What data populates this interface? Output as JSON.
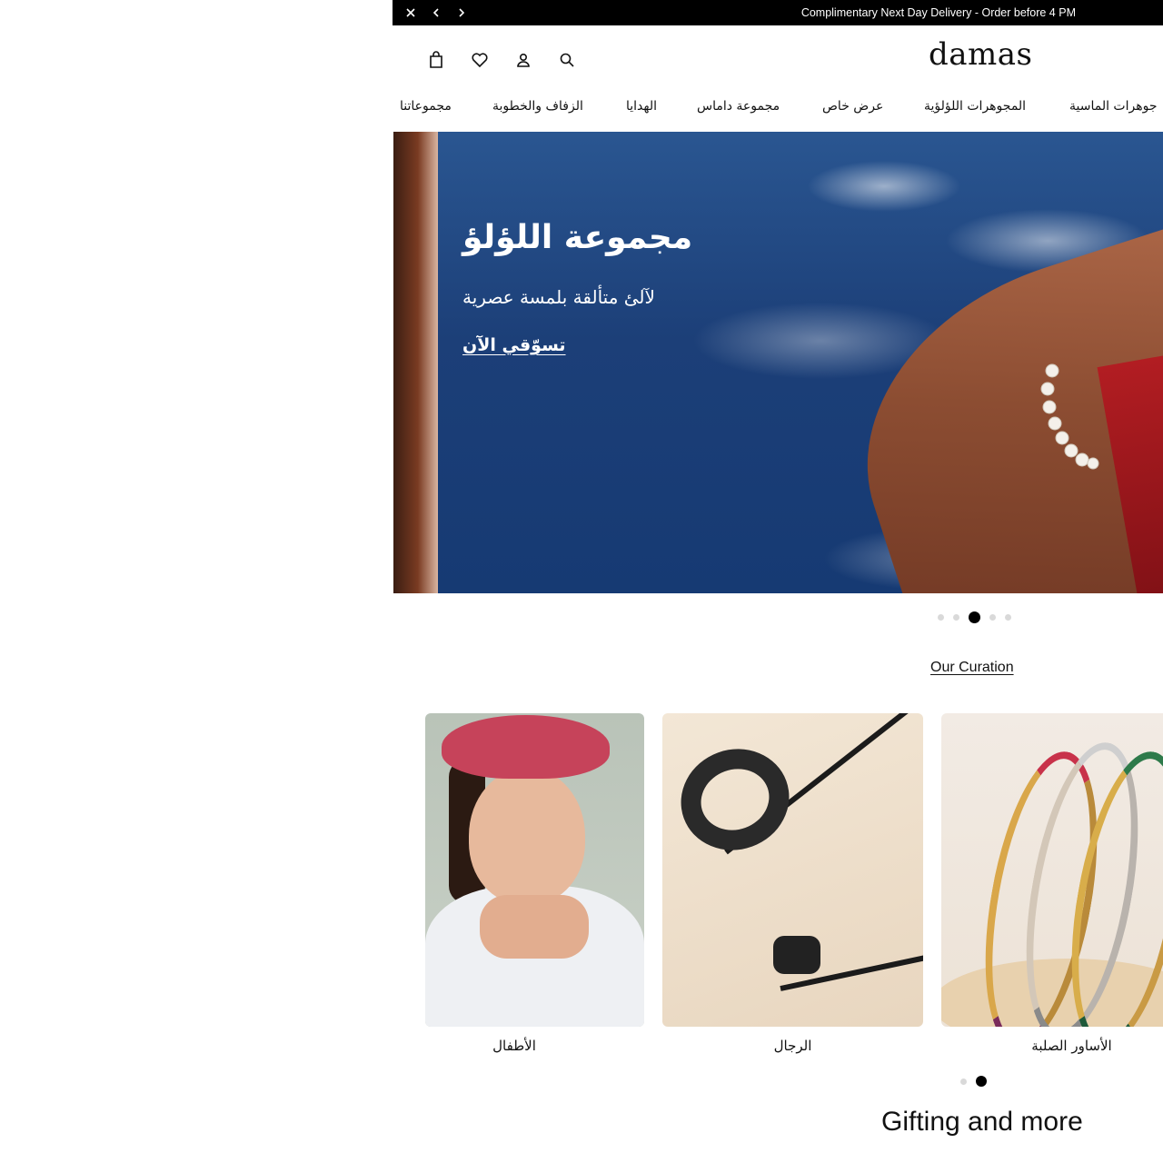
{
  "announcement": {
    "message": "Complimentary Next Day Delivery - Order before 4 PM"
  },
  "header": {
    "logo": "damas"
  },
  "nav": {
    "items": [
      "جوهرات الماسية",
      "المجوهرات اللؤلؤية",
      "عرض خاص",
      "مجموعة داماس",
      "الهدايا",
      "الزفاف والخطوبة",
      "مجموعاتنا"
    ]
  },
  "hero": {
    "title": "مجموعة اللؤلؤ",
    "subtitle": "لآلئ متألقة بلمسة عصرية",
    "cta": "تسوّقي الآن",
    "slide_count": 5,
    "active_slide": 3
  },
  "curation": {
    "link": "Our Curation",
    "cards": [
      {
        "label": "الأطفال"
      },
      {
        "label": "الرجال"
      },
      {
        "label": "الأساور الصلبة"
      }
    ],
    "page_count": 2,
    "active_page": 2
  },
  "gifting": {
    "title": "Gifting and more"
  }
}
